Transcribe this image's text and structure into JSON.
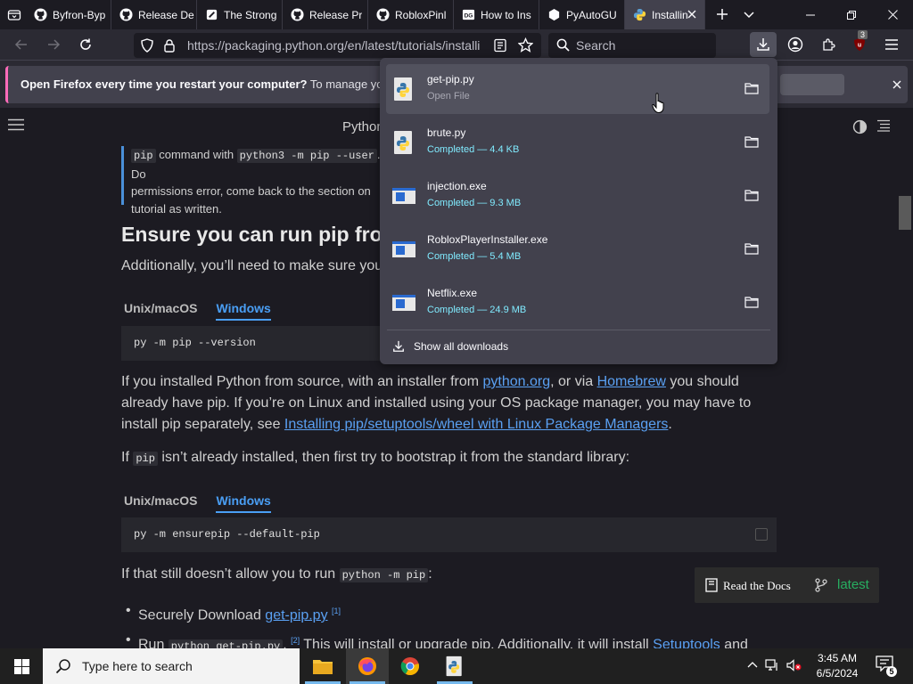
{
  "browser": {
    "tabs": [
      {
        "label": "Byfron-Byp",
        "icon": "github-icon"
      },
      {
        "label": "Release De",
        "icon": "github-icon"
      },
      {
        "label": "The Strong",
        "icon": "page-icon"
      },
      {
        "label": "Release Pr",
        "icon": "github-icon"
      },
      {
        "label": "RobloxPinl",
        "icon": "github-icon"
      },
      {
        "label": "How to Ins",
        "icon": "dg-icon"
      },
      {
        "label": "PyAutoGU",
        "icon": "hexagon-icon"
      },
      {
        "label": "Installin",
        "icon": "python-icon",
        "active": true
      }
    ],
    "url": "https://packaging.python.org/en/latest/tutorials/installi",
    "search_placeholder": "Search",
    "extension_badge": "3",
    "notification": {
      "bold": "Open Firefox every time you restart your computer?",
      "rest": " To manage your Start"
    }
  },
  "downloads": {
    "items": [
      {
        "name": "get-pip.py",
        "status": "Open File",
        "type": "python"
      },
      {
        "name": "brute.py",
        "status": "Completed — 4.4 KB",
        "type": "python"
      },
      {
        "name": "injection.exe",
        "status": "Completed — 9.3 MB",
        "type": "exe"
      },
      {
        "name": "RobloxPlayerInstaller.exe",
        "status": "Completed — 5.4 MB",
        "type": "exe"
      },
      {
        "name": "Netflix.exe",
        "status": "Completed — 24.9 MB",
        "type": "exe"
      }
    ],
    "show_all": "Show all downloads"
  },
  "page": {
    "title": "Python",
    "note_pre": "command with",
    "note_code1": "pip",
    "note_code2": "python3 -m pip --user",
    "note_mid": ". Do",
    "note_line2": "permissions error, come back to the section on",
    "note_line3": "tutorial as written.",
    "heading": "Ensure you can run pip fro",
    "subtext": "Additionally, you’ll need to make sure you",
    "tab_unix": "Unix/macOS",
    "tab_windows": "Windows",
    "code1": "py -m pip --version",
    "p1_a": "If you installed Python from source, with an installer from ",
    "p1_link1": "python.org",
    "p1_b": ", or via ",
    "p1_link2": "Homebrew",
    "p1_c": " you should already have pip. If you’re on Linux and installed using your OS package manager, you may have to install pip separately, see ",
    "p1_link3": "Installing pip/setuptools/wheel with Linux Package Managers",
    "p1_d": ".",
    "p2_a": "If ",
    "p2_code": "pip",
    "p2_b": " isn’t already installed, then first try to bootstrap it from the standard library:",
    "code2": "py -m ensurepip --default-pip",
    "p3_a": "If that still doesn’t allow you to run ",
    "p3_code": "python -m pip",
    "p3_b": ":",
    "bullet1_a": "Securely Download ",
    "bullet1_link": "get-pip.py",
    "bullet1_sup": "[1]",
    "bullet2_a": "Run ",
    "bullet2_code": "python get-pip.py",
    "bullet2_sup": "[2]",
    "bullet2_b": " This will install or upgrade pip. Additionally, it will install ",
    "bullet2_link": "Setuptools",
    "bullet2_c": " and",
    "rtd_label": "Read the Docs",
    "rtd_version": "latest"
  },
  "taskbar": {
    "search_placeholder": "Type here to search",
    "time": "3:45 AM",
    "date": "6/5/2024",
    "notification_count": "5"
  }
}
